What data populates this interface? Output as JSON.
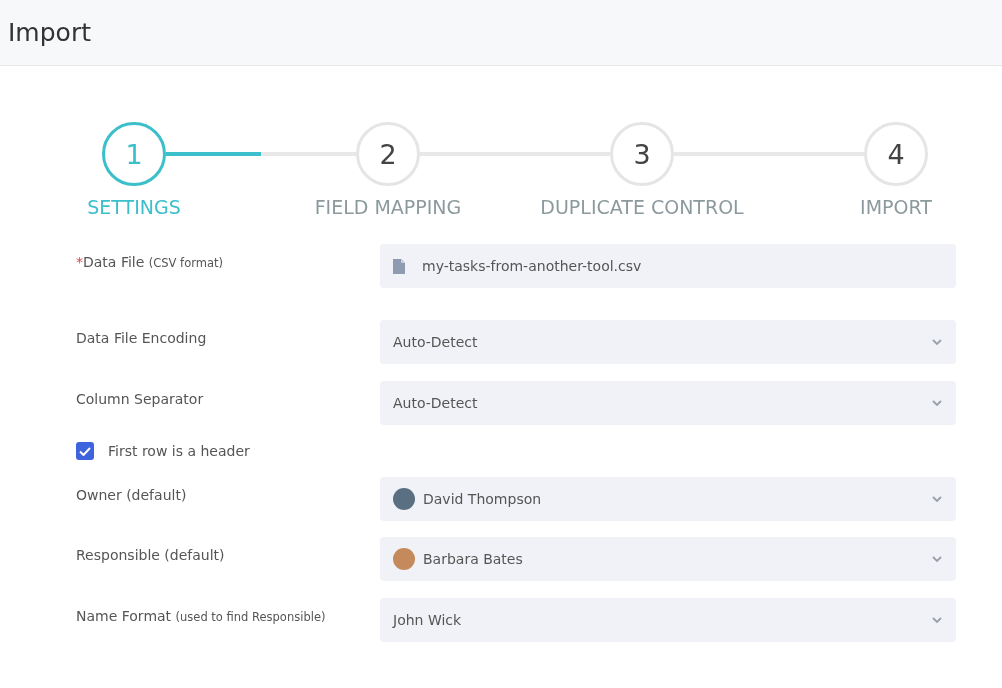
{
  "title": "Import",
  "steps": [
    {
      "number": "1",
      "label": "SETTINGS",
      "selected": true
    },
    {
      "number": "2",
      "label": "FIELD MAPPING",
      "selected": false
    },
    {
      "number": "3",
      "label": "DUPLICATE CONTROL",
      "selected": false
    },
    {
      "number": "4",
      "label": "IMPORT",
      "selected": false
    }
  ],
  "form": [
    {
      "kind": "file",
      "required": true,
      "required_mark": "*",
      "label": "Data File",
      "hint": "(CSV format)",
      "value": "my-tasks-from-another-tool.csv"
    },
    {
      "kind": "select",
      "label": "Data File Encoding",
      "value": "Auto-Detect"
    },
    {
      "kind": "select",
      "label": "Column Separator",
      "value": "Auto-Detect"
    },
    {
      "kind": "checkbox",
      "label": "First row is a header",
      "checked": true
    },
    {
      "kind": "person",
      "label": "Owner (default)",
      "value": "David Thompson"
    },
    {
      "kind": "person",
      "label": "Responsible (default)",
      "value": "Barbara Bates"
    },
    {
      "kind": "select",
      "label": "Name Format",
      "hint": "(used to find Responsible)",
      "value": "John Wick"
    }
  ]
}
